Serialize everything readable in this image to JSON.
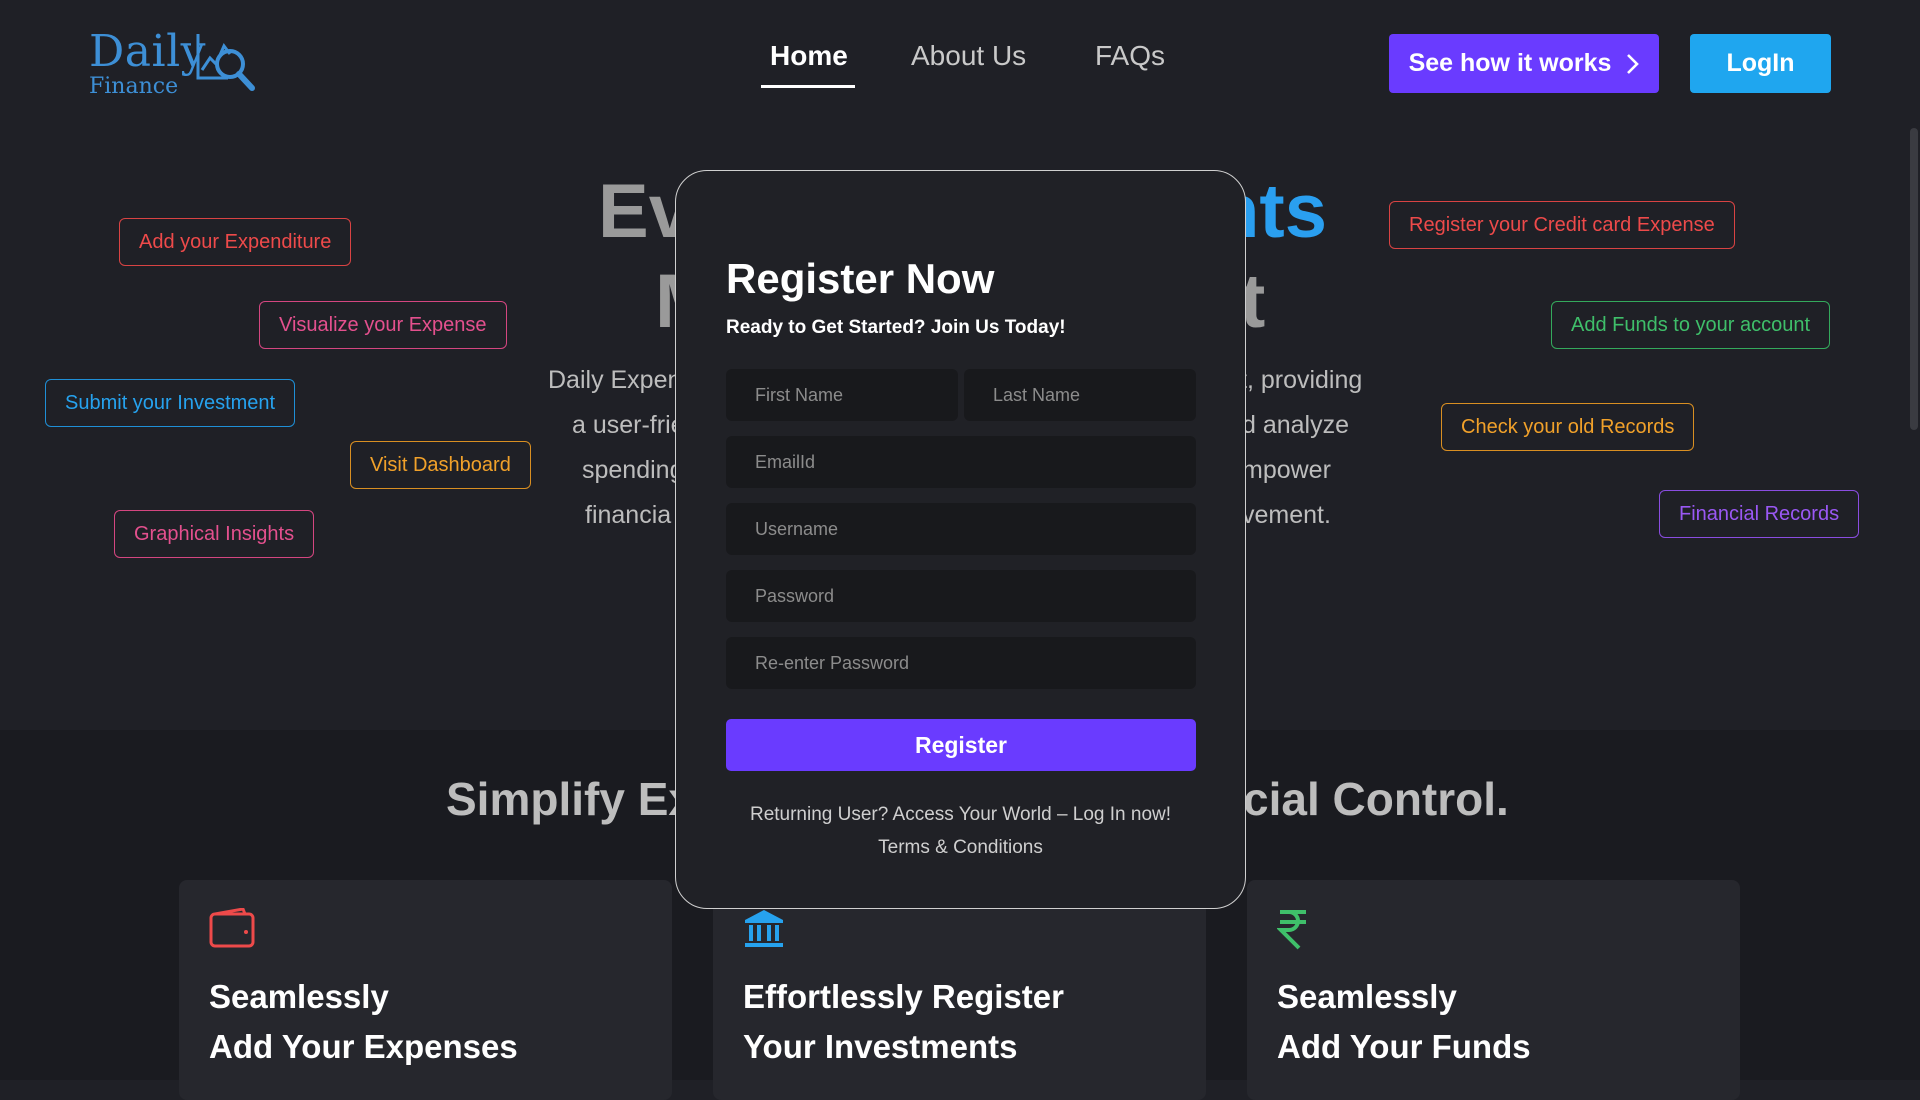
{
  "brand": {
    "name": "Daily",
    "sub": "Finance",
    "color": "#3d8fd6"
  },
  "nav": {
    "items": [
      {
        "label": "Home",
        "active": true
      },
      {
        "label": "About Us",
        "active": false
      },
      {
        "label": "FAQs",
        "active": false
      }
    ]
  },
  "header_buttons": {
    "how_label": "See how it works",
    "how_icon": "chevron-right-icon",
    "login_label": "LogIn",
    "accent": "#6a3bff",
    "login_color": "#1fa6ef"
  },
  "hero": {
    "line1_left": "Ev",
    "line1_right": "nts",
    "line2_left": "M",
    "line2_right": "t",
    "desc_lines": [
      {
        "left": "Daily Expen",
        "right": "t, providing"
      },
      {
        "left": "a user-frie",
        "right": "d analyze"
      },
      {
        "left": "spending",
        "right": "mpower"
      },
      {
        "left": "financia",
        "right": "vement."
      }
    ]
  },
  "tags": [
    {
      "label": "Add your Expenditure",
      "color": "red"
    },
    {
      "label": "Visualize your Expense",
      "color": "pink"
    },
    {
      "label": "Submit your Investment",
      "color": "blue"
    },
    {
      "label": "Visit Dashboard",
      "color": "orange"
    },
    {
      "label": "Graphical Insights",
      "color": "pink"
    },
    {
      "label": "Register your Credit card Expense",
      "color": "red"
    },
    {
      "label": "Add Funds to your account",
      "color": "green"
    },
    {
      "label": "Check your old Records",
      "color": "orange"
    },
    {
      "label": "Financial Records",
      "color": "purple"
    }
  ],
  "section2": {
    "title_left": "Simplify Exp",
    "title_right": "cial Control.",
    "cards": [
      {
        "icon": "wallet-icon",
        "icon_color": "#ee4a4a",
        "line1": "Seamlessly",
        "line2": "Add Your Expenses"
      },
      {
        "icon": "bank-icon",
        "icon_color": "#26a2ee",
        "line1": "Effortlessly Register",
        "line2": "Your Investments"
      },
      {
        "icon": "rupee-icon",
        "icon_color": "#3fbf6a",
        "line1": "Seamlessly",
        "line2": "Add Your Funds"
      }
    ]
  },
  "modal": {
    "title": "Register Now",
    "subtitle": "Ready to Get Started? Join Us Today!",
    "placeholders": {
      "first_name": "First Name",
      "last_name": "Last Name",
      "email": "EmailId",
      "username": "Username",
      "password": "Password",
      "reenter": "Re-enter Password"
    },
    "register_label": "Register",
    "returning_text": "Returning User? Access Your World – Log In now!",
    "terms_text": "Terms & Conditions"
  }
}
